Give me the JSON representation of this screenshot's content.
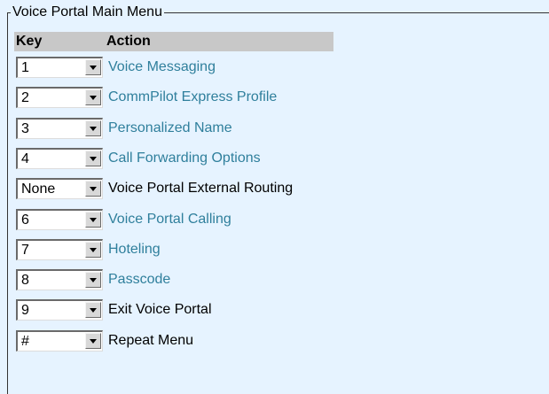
{
  "menu": {
    "title": "Voice Portal Main Menu",
    "headers": {
      "key": "Key",
      "action": "Action"
    },
    "rows": [
      {
        "key": "1",
        "action": "Voice Messaging",
        "is_link": true
      },
      {
        "key": "2",
        "action": "CommPilot Express Profile",
        "is_link": true
      },
      {
        "key": "3",
        "action": "Personalized Name",
        "is_link": true
      },
      {
        "key": "4",
        "action": "Call Forwarding Options",
        "is_link": true
      },
      {
        "key": "None",
        "action": "Voice Portal External Routing",
        "is_link": false
      },
      {
        "key": "6",
        "action": "Voice Portal Calling",
        "is_link": true
      },
      {
        "key": "7",
        "action": "Hoteling",
        "is_link": true
      },
      {
        "key": "8",
        "action": "Passcode",
        "is_link": true
      },
      {
        "key": "9",
        "action": "Exit Voice Portal",
        "is_link": false
      },
      {
        "key": "#",
        "action": "Repeat Menu",
        "is_link": false
      }
    ]
  },
  "colors": {
    "panel_background": "#e6f3ff",
    "header_background": "#c8c8c8",
    "link_text": "#2f7f9c",
    "plain_text": "#000000"
  },
  "icons": {
    "dropdown": "chevron-down-icon"
  }
}
